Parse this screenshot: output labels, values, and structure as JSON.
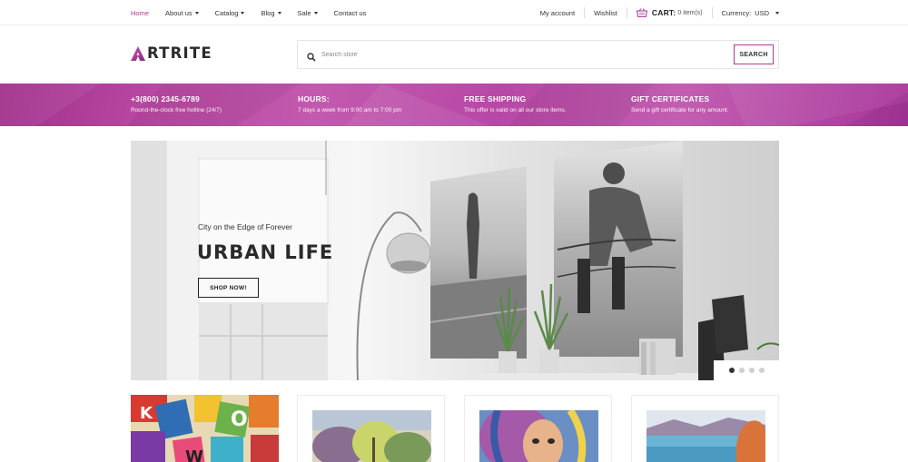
{
  "topnav": {
    "items": [
      {
        "label": "Home",
        "active": true,
        "has_dropdown": false
      },
      {
        "label": "About us",
        "active": false,
        "has_dropdown": true
      },
      {
        "label": "Catalog",
        "active": false,
        "has_dropdown": true
      },
      {
        "label": "Blog",
        "active": false,
        "has_dropdown": true
      },
      {
        "label": "Sale",
        "active": false,
        "has_dropdown": true
      },
      {
        "label": "Contact us",
        "active": false,
        "has_dropdown": false
      }
    ],
    "my_account": "My account",
    "wishlist": "Wishlist",
    "cart_label": "CART:",
    "cart_count": "0 item(s)",
    "currency_label": "Currency:",
    "currency_value": "USD"
  },
  "header": {
    "logo_text": "RTRITE",
    "search_placeholder": "Search store",
    "search_button": "SEARCH"
  },
  "infobar": {
    "items": [
      {
        "title": "+3(800) 2345-6789",
        "subtitle": "Round-the-clock free hotline (24/7)"
      },
      {
        "title": "HOURS:",
        "subtitle": "7 days a week from 9:00 am to 7:00 pm"
      },
      {
        "title": "FREE SHIPPING",
        "subtitle": "This offer is valid on all our store items."
      },
      {
        "title": "GIFT CERTIFICATES",
        "subtitle": "Send a gift certificate for any amount."
      }
    ]
  },
  "hero": {
    "subtitle": "City on the Edge of Forever",
    "title": "URBAN LIFE",
    "button": "SHOP NOW!",
    "slide_count": 4,
    "active_slide": 1
  },
  "colors": {
    "accent": "#b13b95",
    "infobar_base": "#bb4aa4"
  },
  "icons": {
    "search": "magnifier",
    "cart": "basket",
    "logo": "triangle-a"
  }
}
